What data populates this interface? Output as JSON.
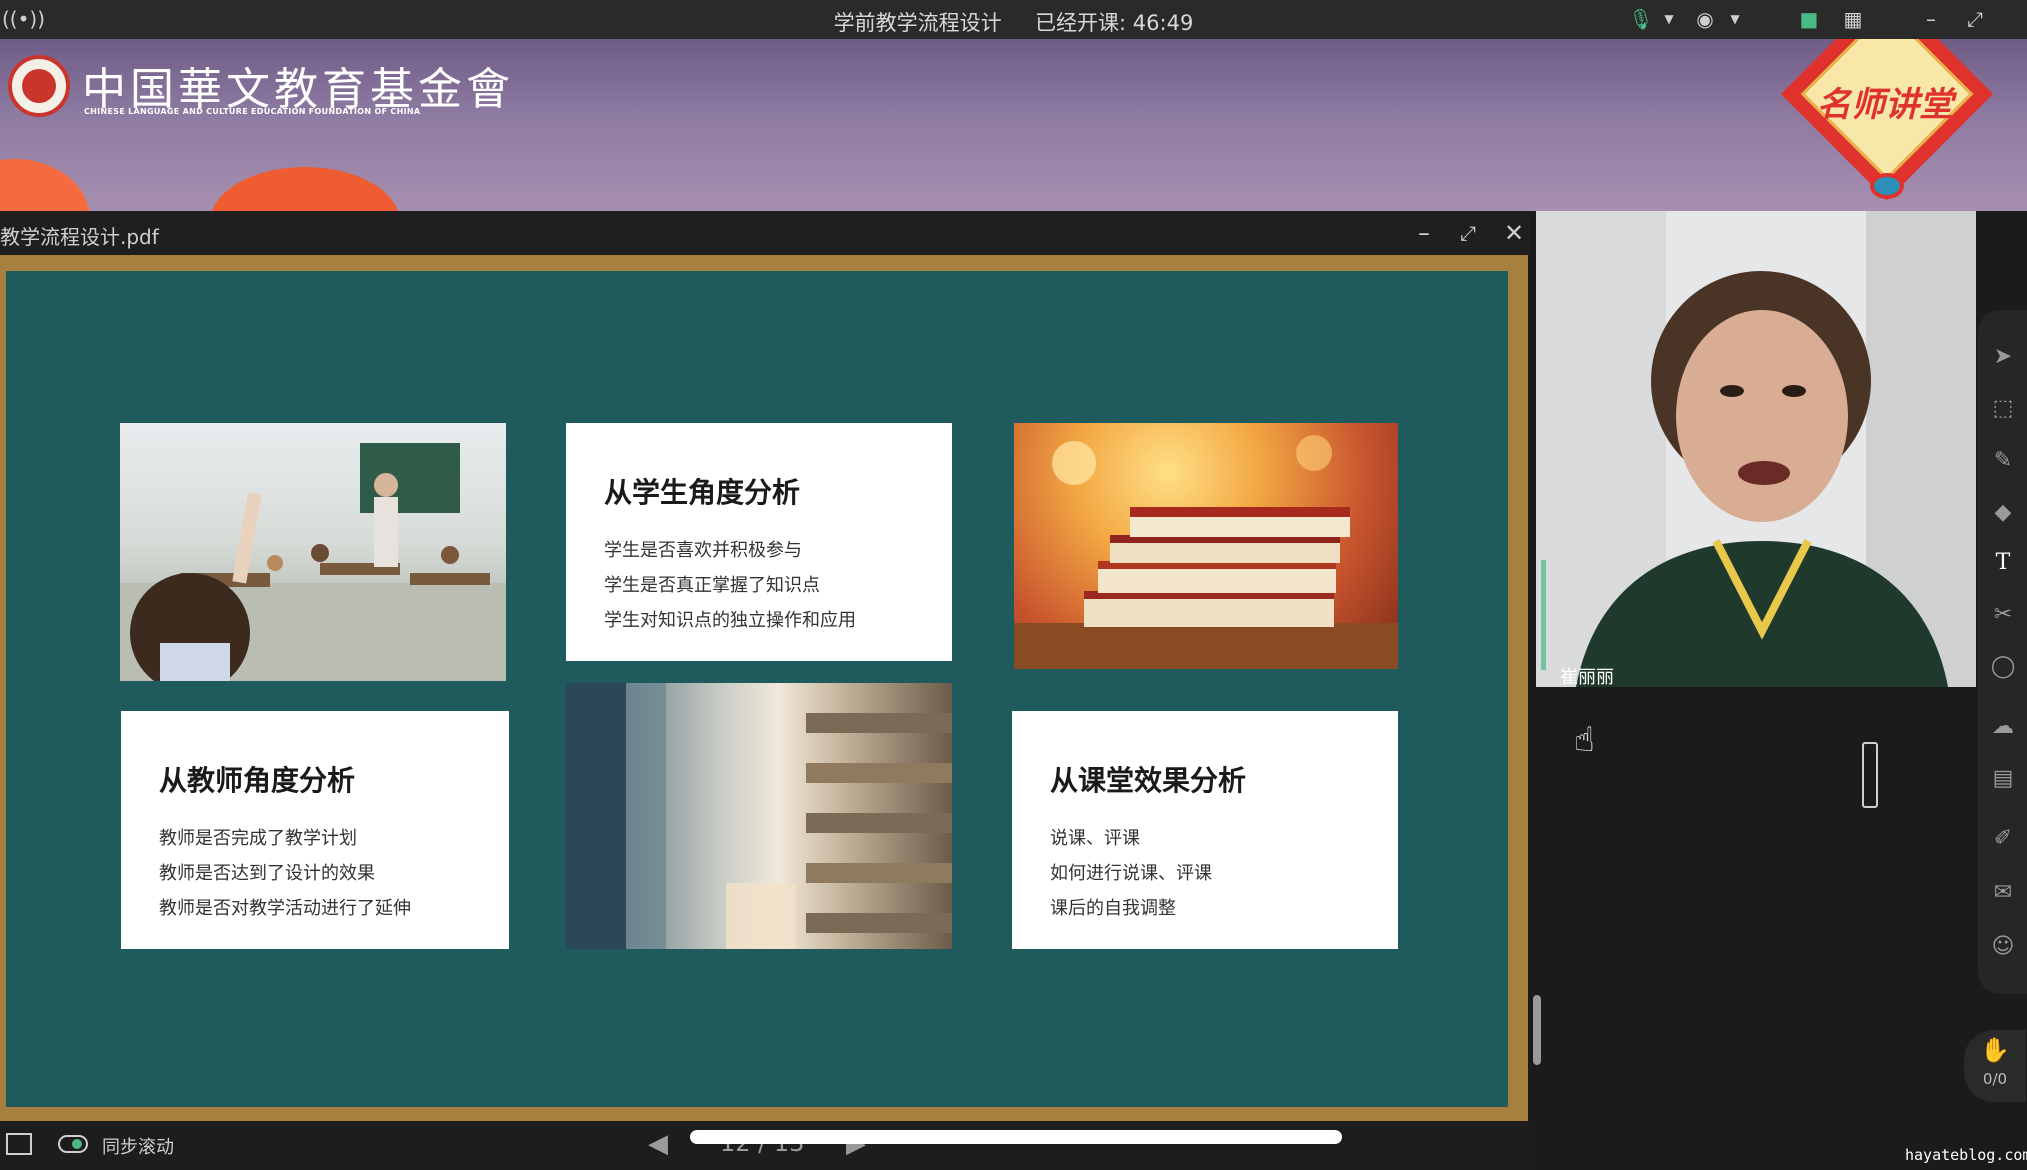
{
  "top_bar": {
    "course_title": "学前教学流程设计",
    "elapsed_label": "已经开课: 46:49"
  },
  "banner": {
    "org_name": "中国華文教育基金會",
    "org_name_en": "CHINESE LANGUAGE AND CULTURE EDUCATION FOUNDATION OF CHINA",
    "badge_text": "名师讲堂"
  },
  "pdf": {
    "filename": "教学流程设计.pdf",
    "cards": [
      {
        "heading": "从学生角度分析",
        "lines": [
          "学生是否喜欢并积极参与",
          "学生是否真正掌握了知识点",
          "学生对知识点的独立操作和应用"
        ]
      },
      {
        "heading": "从教师角度分析",
        "lines": [
          "教师是否完成了教学计划",
          "教师是否达到了设计的效果",
          "教师是否对教学活动进行了延伸"
        ]
      },
      {
        "heading": "从课堂效果分析",
        "lines": [
          "说课、评课",
          "如何进行说课、评课",
          "课后的自我调整"
        ]
      }
    ]
  },
  "bottom_bar": {
    "sync_label": "同步滚动",
    "page_indicator": "12 / 13"
  },
  "video": {
    "participant_name": "崔丽丽"
  },
  "toolbar": {
    "counter": "0/0"
  },
  "watermark": "hayateblog.com",
  "colors": {
    "board": "#1f5a5c",
    "frame": "#a6803f",
    "banner": "#8e7ba2",
    "accent_red": "#e0322c"
  }
}
